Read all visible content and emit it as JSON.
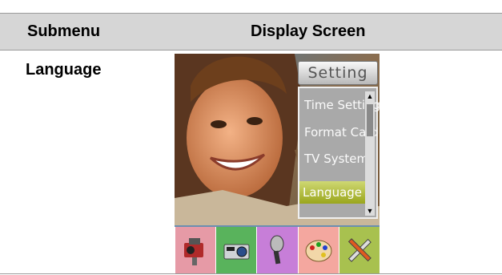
{
  "table": {
    "header_submenu": "Submenu",
    "header_display": "Display Screen",
    "row_submenu": "Language"
  },
  "screen": {
    "menu_title": "Setting",
    "menu_items": [
      "Time Setting",
      "Format Card",
      "TV System",
      "Language"
    ],
    "selected_item": "Language",
    "mode_icons": [
      {
        "name": "video-camera-icon",
        "color": "#e69aa6"
      },
      {
        "name": "camera-icon",
        "color": "#59b35c"
      },
      {
        "name": "microphone-icon",
        "color": "#c77ed8"
      },
      {
        "name": "palette-icon",
        "color": "#f4a79f"
      },
      {
        "name": "tools-icon",
        "color": "#a8c14f"
      }
    ]
  },
  "colors": {
    "header_bg": "#d6d6d6",
    "selected_bg": "#a5b12a"
  }
}
